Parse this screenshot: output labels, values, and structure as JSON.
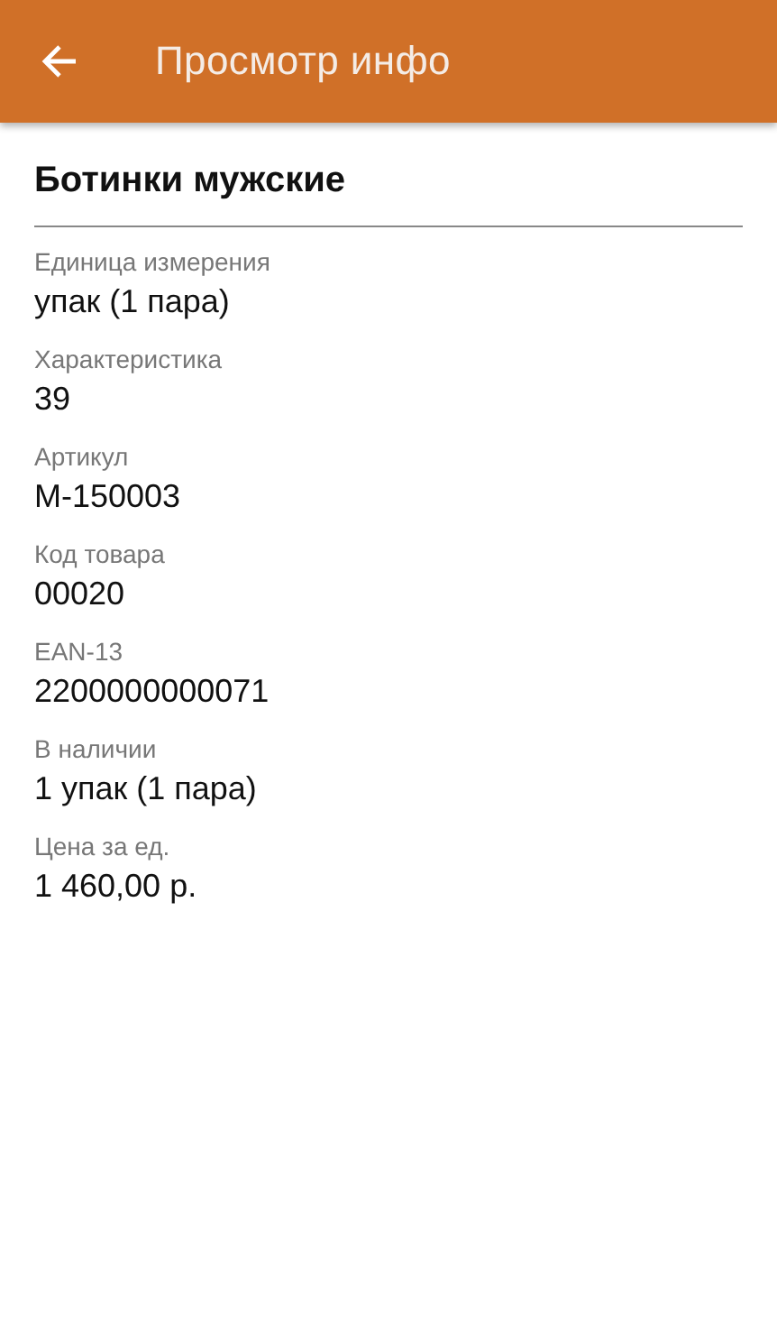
{
  "app_bar": {
    "title": "Просмотр инфо"
  },
  "product": {
    "name": "Ботинки мужские"
  },
  "fields": [
    {
      "label": "Единица измерения",
      "value": "упак (1 пара)"
    },
    {
      "label": "Характеристика",
      "value": "39"
    },
    {
      "label": "Артикул",
      "value": "М-150003"
    },
    {
      "label": "Код товара",
      "value": "00020"
    },
    {
      "label": "EAN-13",
      "value": "2200000000071"
    },
    {
      "label": "В наличии",
      "value": "1 упак (1 пара)"
    },
    {
      "label": "Цена за ед.",
      "value": "1 460,00 р."
    }
  ]
}
